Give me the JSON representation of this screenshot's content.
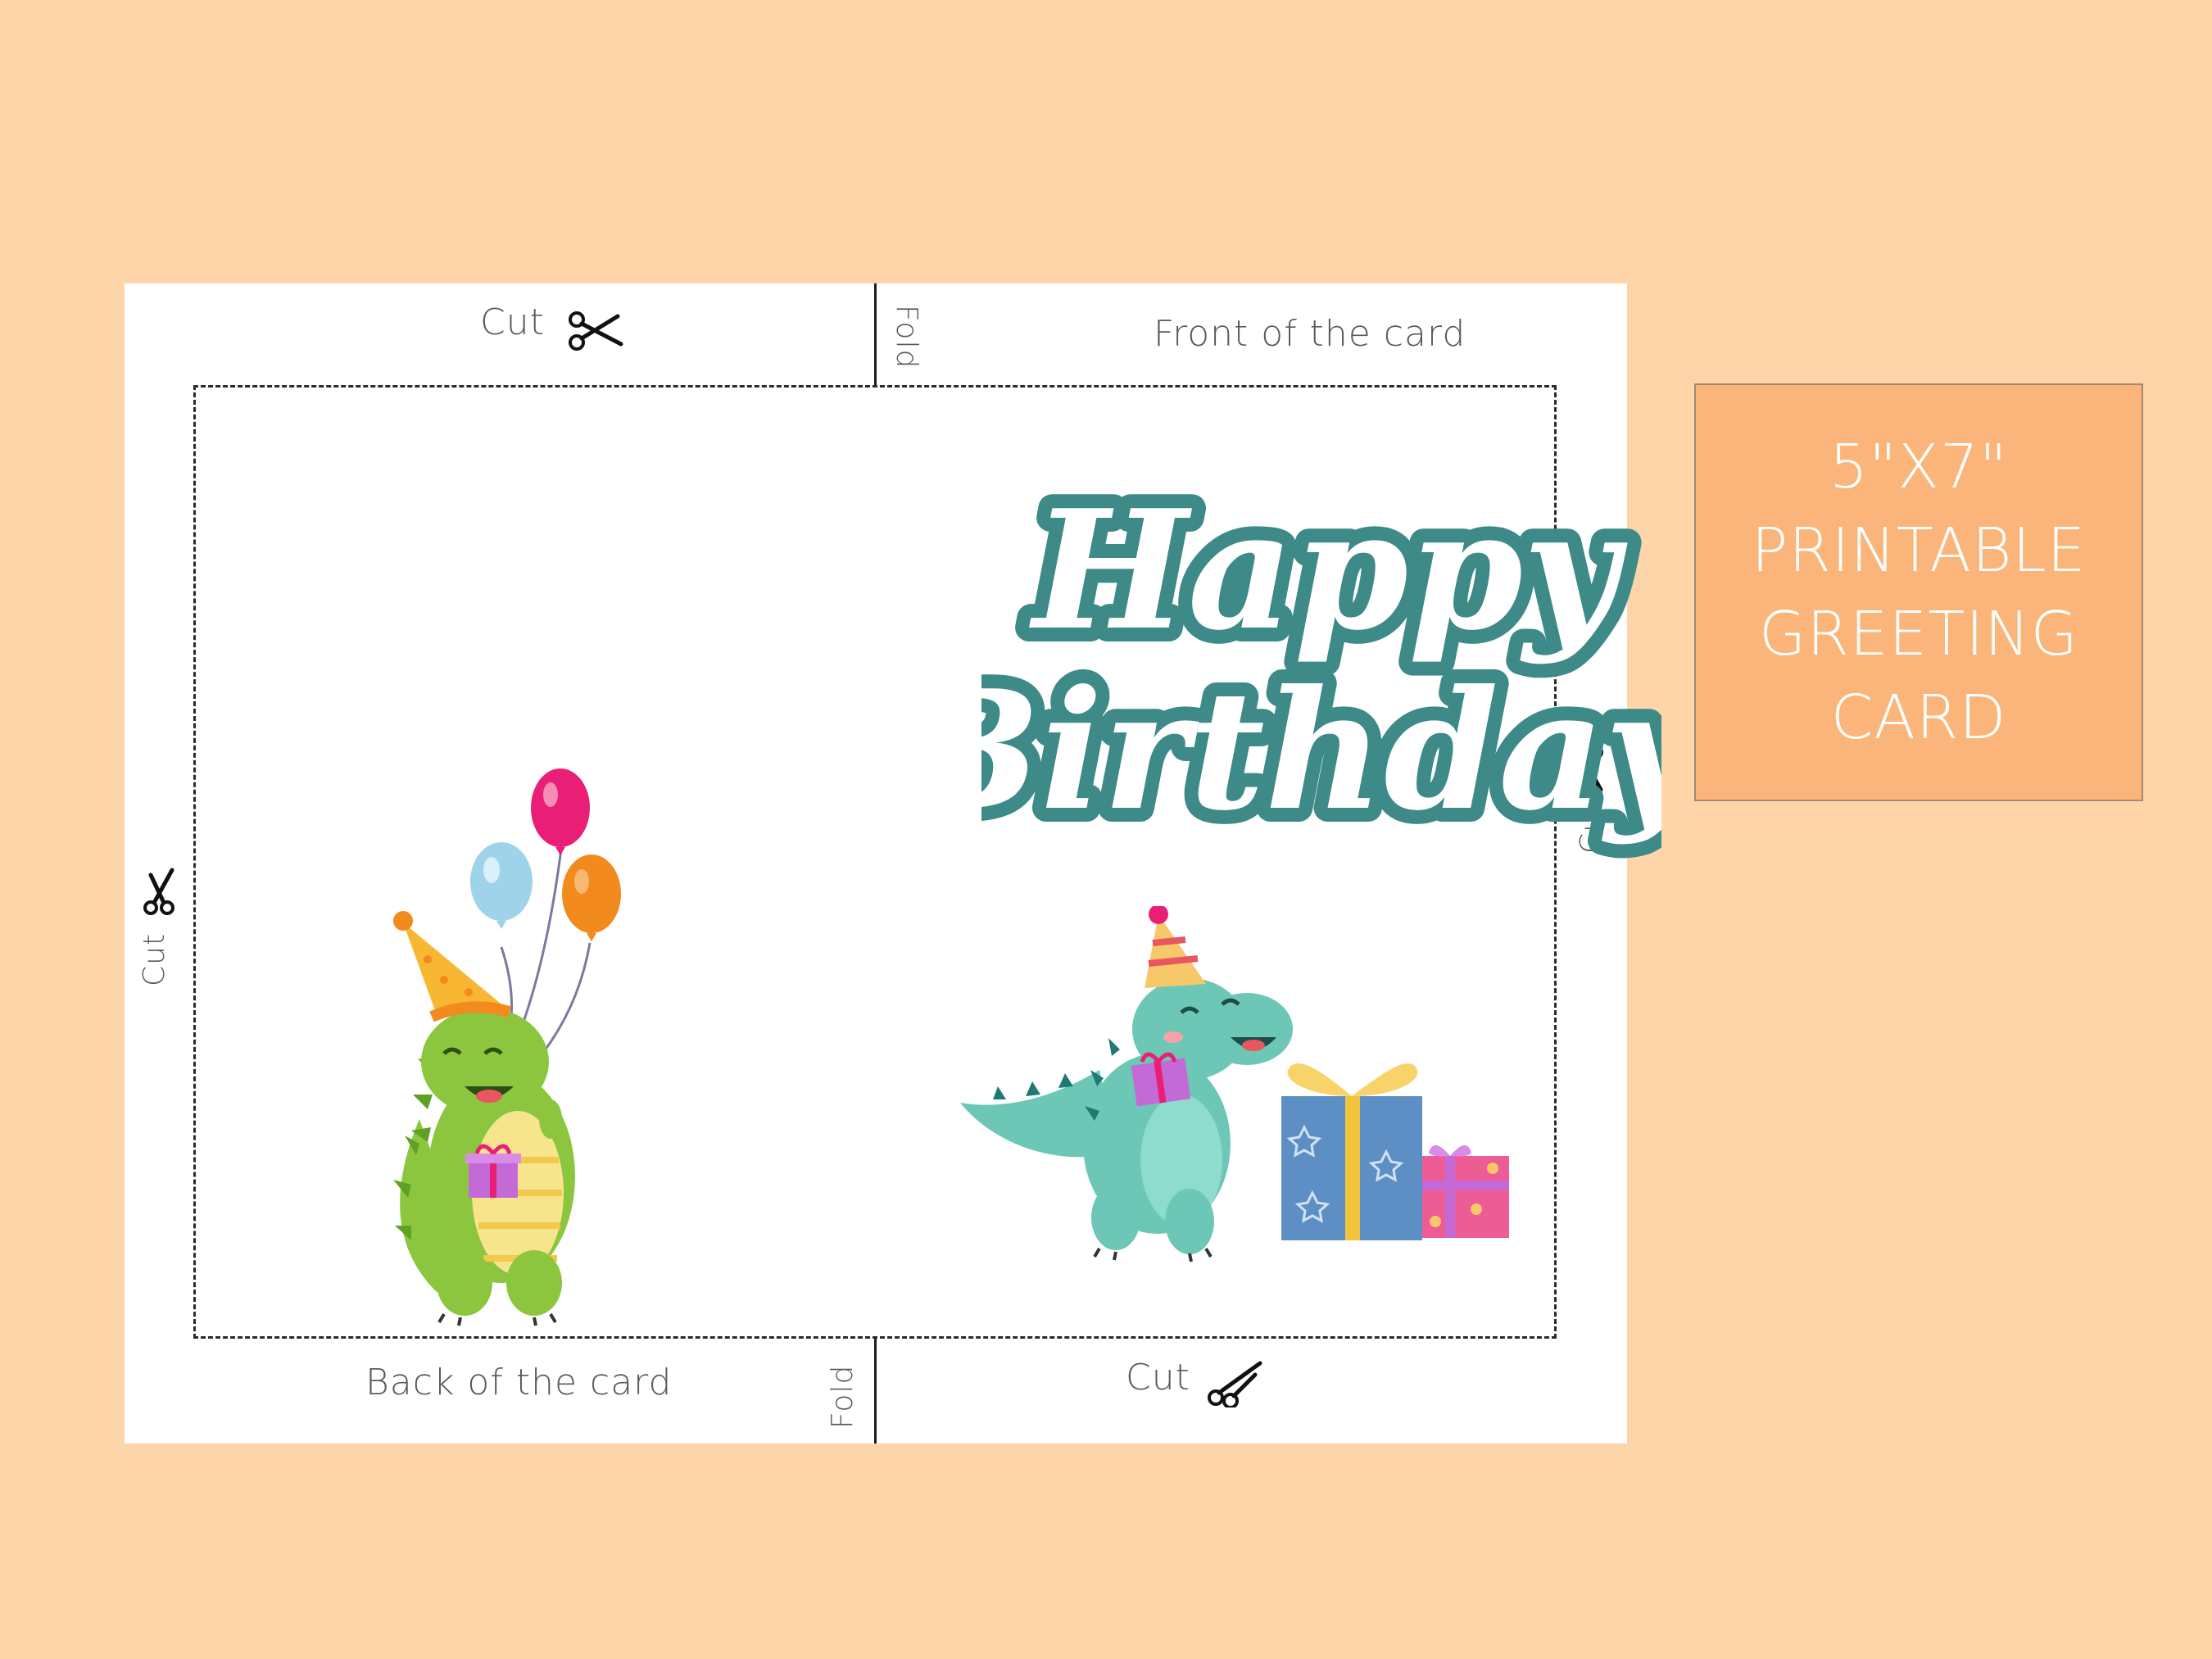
{
  "sheet": {
    "labels": {
      "cut_top": "Cut",
      "front": "Front of the card",
      "fold_top": "Fold",
      "cut_left": "Cut",
      "cut_right": "Cut",
      "back": "Back of the card",
      "fold_bottom": "Fold",
      "cut_bottom": "Cut"
    },
    "front": {
      "greeting_line1": "Happy",
      "greeting_line2": "Birthday"
    }
  },
  "badge": {
    "line1": "5\"X7\"",
    "line2": "PRINTABLE",
    "line3": "GREETING",
    "line4": "CARD"
  },
  "colors": {
    "background": "#fdd5a9",
    "badge": "#fbb57a",
    "title_teal": "#3d8a88",
    "green_dino": "#8cc63f",
    "teal_dino": "#6cc7b6"
  },
  "icons": [
    "scissors-icon",
    "balloon-icon",
    "gift-icon",
    "party-hat-icon"
  ]
}
